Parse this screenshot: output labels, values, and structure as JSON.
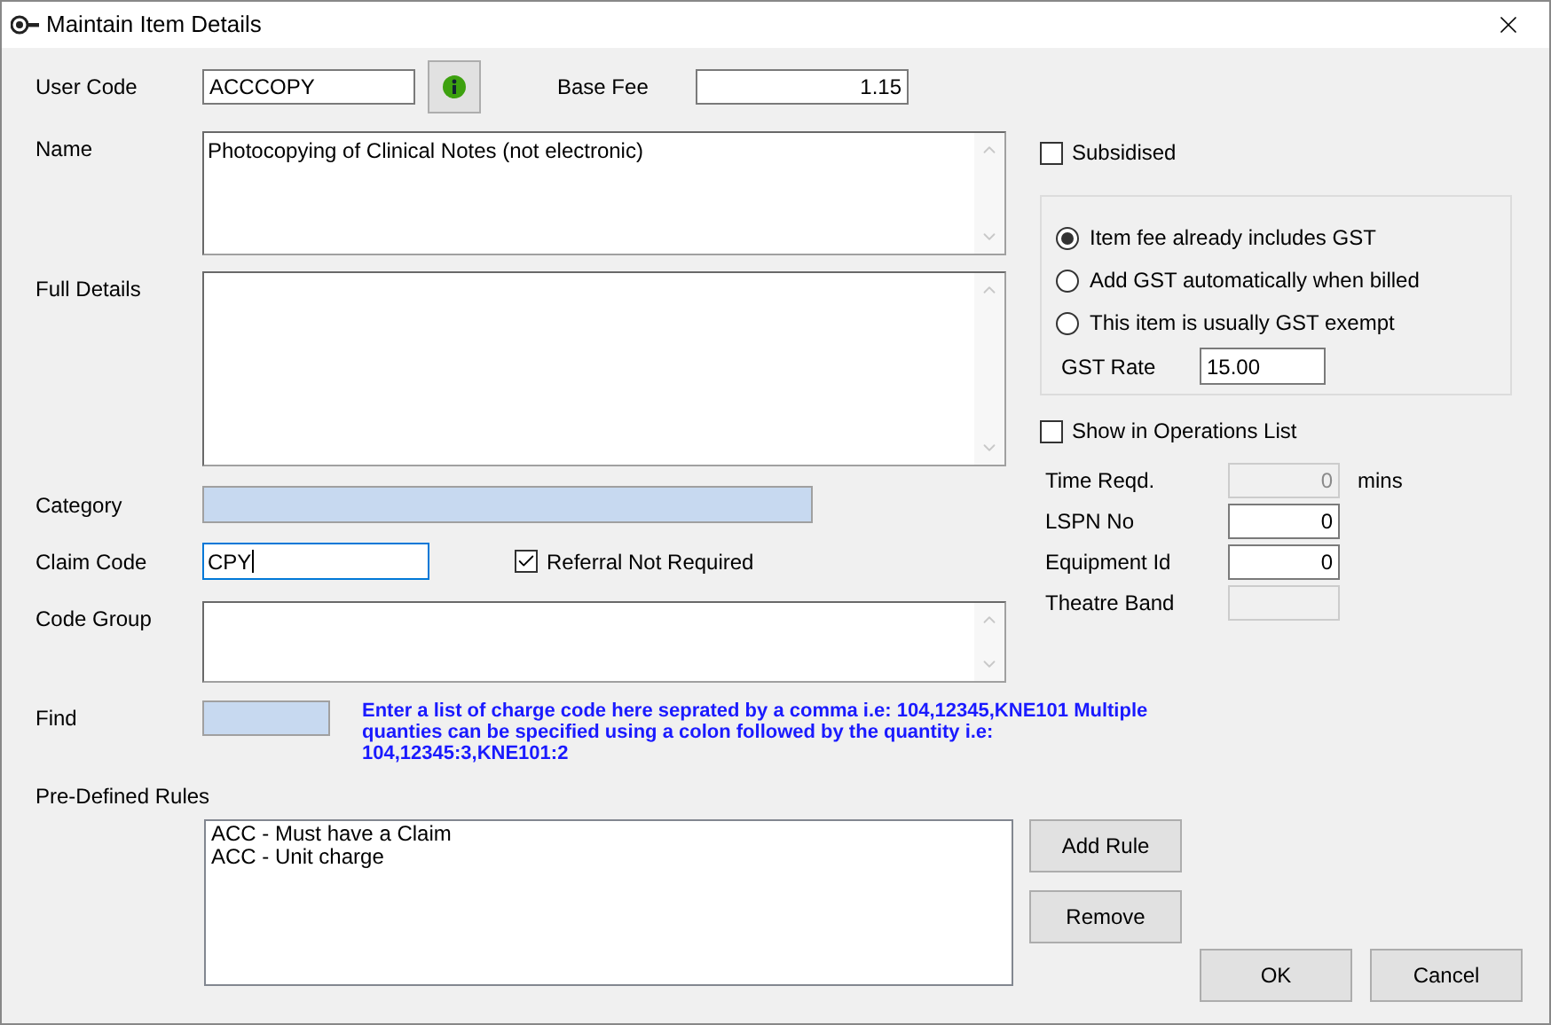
{
  "window": {
    "title": "Maintain Item Details"
  },
  "user_code": {
    "label": "User Code",
    "value": "ACCCOPY"
  },
  "base_fee": {
    "label": "Base Fee",
    "value": "1.15"
  },
  "name": {
    "label": "Name",
    "value": "Photocopying of Clinical Notes (not electronic)"
  },
  "full_details": {
    "label": "Full Details"
  },
  "category": {
    "label": "Category"
  },
  "claim_code": {
    "label": "Claim Code",
    "value": "CPY"
  },
  "referral": {
    "label": "Referral Not Required",
    "checked": true
  },
  "code_group": {
    "label": "Code Group"
  },
  "find": {
    "label": "Find",
    "note": "Enter a list of charge code here seprated by a comma i.e: 104,12345,KNE101 Multiple quanties can be specified using a colon followed by the quantity i.e: 104,12345:3,KNE101:2"
  },
  "predefined_rules": {
    "label": "Pre-Defined Rules",
    "items": [
      "ACC - Must have a Claim",
      "ACC - Unit charge"
    ]
  },
  "rule_buttons": [
    "Add Rule",
    "Remove"
  ],
  "subsidised": {
    "label": "Subsidised",
    "checked": false
  },
  "gst_options": [
    {
      "label": "Item fee already includes GST",
      "selected": true
    },
    {
      "label": "Add GST automatically when billed",
      "selected": false
    },
    {
      "label": "This item is usually GST exempt",
      "selected": false
    }
  ],
  "gst_rate": {
    "label": "GST Rate",
    "value": "15.00"
  },
  "show_in_operations": {
    "label": "Show in Operations List",
    "checked": false
  },
  "extra_fields": [
    {
      "label": "Time Reqd.",
      "value": "0",
      "unit": "mins",
      "disabled": true
    },
    {
      "label": "LSPN No",
      "value": "0",
      "disabled": false
    },
    {
      "label": "Equipment Id",
      "value": "0",
      "disabled": false
    },
    {
      "label": "Theatre Band",
      "disabled": true
    }
  ],
  "buttons": [
    "OK",
    "Cancel"
  ]
}
